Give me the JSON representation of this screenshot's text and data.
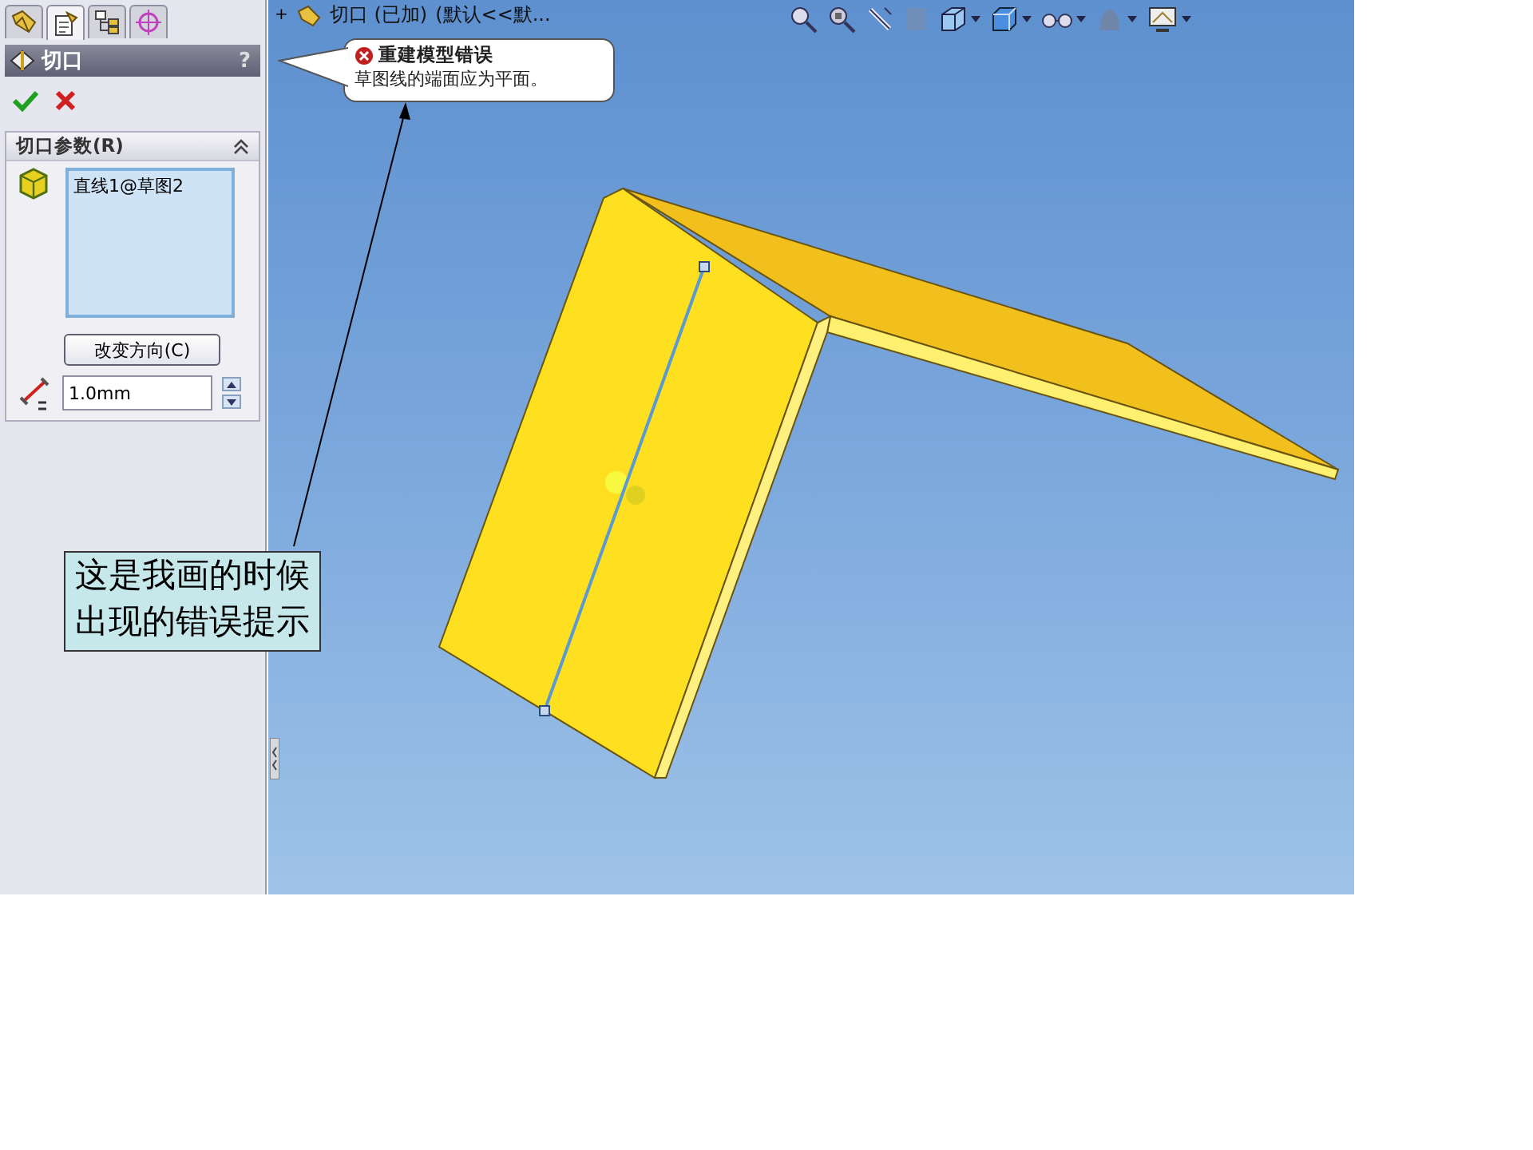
{
  "panel_tabs": [
    {
      "selected": false
    },
    {
      "selected": true
    },
    {
      "selected": false
    },
    {
      "selected": false
    }
  ],
  "feature": {
    "title": "切口",
    "help": "?"
  },
  "section": {
    "title": "切口参数(R)",
    "expanded": true
  },
  "selection": {
    "items": [
      "直线1@草图2"
    ]
  },
  "reverse_button": "改变方向(C)",
  "gap_field": {
    "value": "1.0mm"
  },
  "tree_item": {
    "expander": "+",
    "label": "切口 (已加)",
    "config": "(默认<<默..."
  },
  "error_balloon": {
    "title": "重建模型错误",
    "message": "草图线的端面应为平面。"
  },
  "annotation": {
    "text": "这是我画的时候出现的错误提示"
  }
}
